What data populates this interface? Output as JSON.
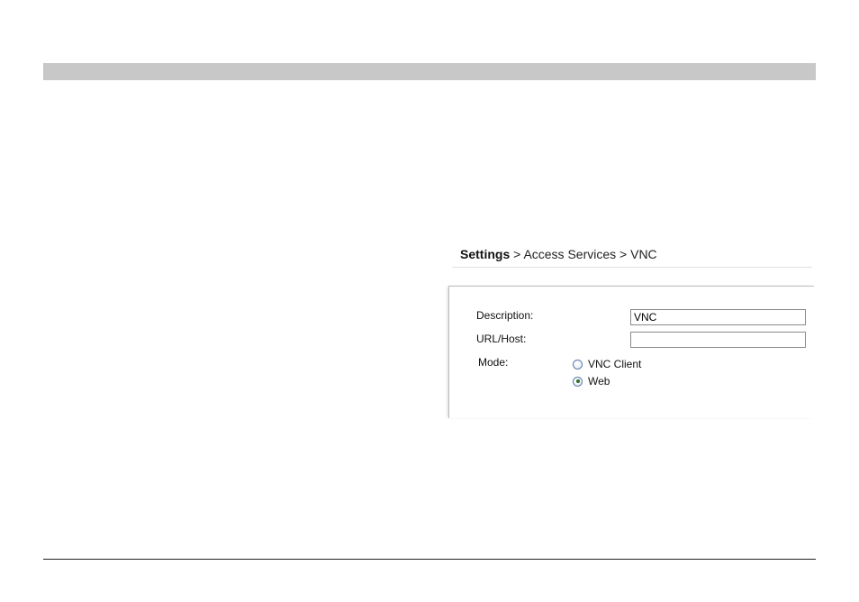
{
  "breadcrumb": {
    "root": "Settings",
    "separator_1": ">",
    "section": "Access Services",
    "separator_2": ">",
    "page": "VNC"
  },
  "form": {
    "description_label": "Description:",
    "description_value": "VNC",
    "url_label": "URL/Host:",
    "url_value": "",
    "mode_label": "Mode:",
    "mode_options": [
      {
        "label": "VNC Client",
        "selected": false
      },
      {
        "label": "Web",
        "selected": true
      }
    ]
  },
  "colors": {
    "header_bar": "#c8c8c8",
    "radio_border": "#5a7aa6",
    "radio_dot": "#2f6b2f"
  }
}
